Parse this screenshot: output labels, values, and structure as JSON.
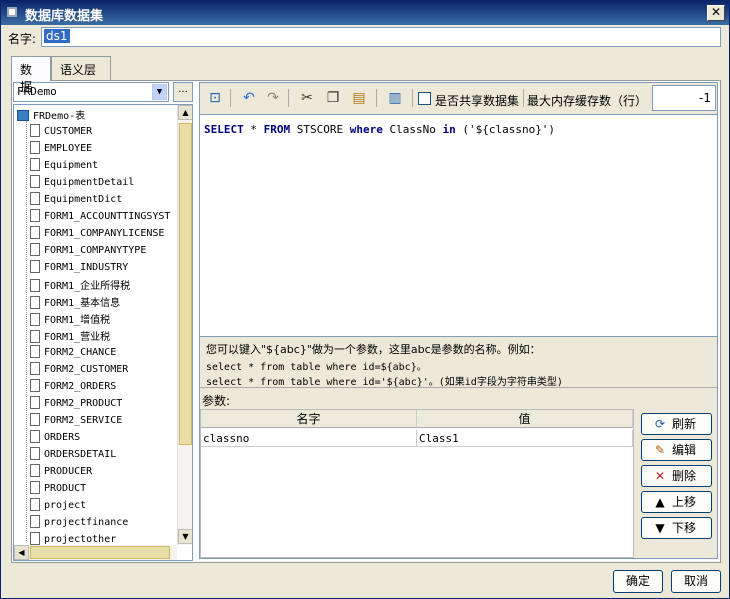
{
  "window": {
    "title": "数据库数据集",
    "close": "✕"
  },
  "name_label": "名字:",
  "name_value": "ds1",
  "tabs": [
    "数据",
    "语义层"
  ],
  "left": {
    "connection": "FRDemo",
    "more": "...",
    "tree_root": "FRDemo-表",
    "tables": [
      "CUSTOMER",
      "EMPLOYEE",
      "Equipment",
      "EquipmentDetail",
      "EquipmentDict",
      "FORM1_ACCOUNTTINGSYST",
      "FORM1_COMPANYLICENSE",
      "FORM1_COMPANYTYPE",
      "FORM1_INDUSTRY",
      "FORM1_企业所得税",
      "FORM1_基本信息",
      "FORM1_增值税",
      "FORM1_营业税",
      "FORM2_CHANCE",
      "FORM2_CUSTOMER",
      "FORM2_ORDERS",
      "FORM2_PRODUCT",
      "FORM2_SERVICE",
      "ORDERS",
      "ORDERSDETAIL",
      "PRODUCER",
      "PRODUCT",
      "project",
      "projectfinance",
      "projectother"
    ]
  },
  "toolbar": {
    "shared_label": "是否共享数据集",
    "max_cache_label": "最大内存缓存数（行）",
    "max_cache_value": "-1"
  },
  "sql": {
    "kw_select": "SELECT",
    "star": " * ",
    "kw_from": "FROM",
    "table": " STSCORE ",
    "kw_where": "where",
    "column": " ClassNo ",
    "kw_in": "in",
    "param_expr": " ('${classno}')"
  },
  "hints": [
    "您可以键入\"${abc}\"做为一个参数，这里abc是参数的名称。例如：",
    "select * from table where id=${abc}。",
    "select * from table where id='${abc}'。(如果id字段为字符串类型)"
  ],
  "params": {
    "label": "参数:",
    "col_name": "名字",
    "col_value": "值",
    "rows": [
      {
        "name": "classno",
        "value": "Class1"
      }
    ]
  },
  "side_buttons": [
    "刷新",
    "编辑",
    "删除",
    "上移",
    "下移"
  ],
  "footer": {
    "ok": "确定",
    "cancel": "取消"
  },
  "colors": {
    "keyword": "#000080",
    "string": "#000000"
  }
}
